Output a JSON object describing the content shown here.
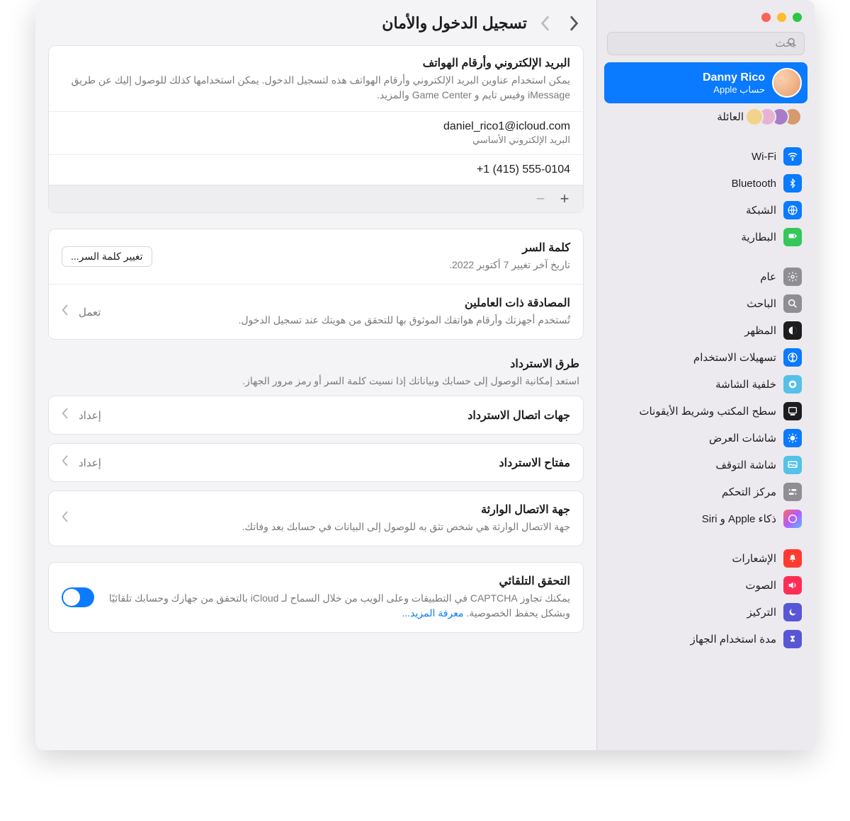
{
  "window": {
    "search_placeholder": "بحث"
  },
  "user": {
    "name": "Danny Rico",
    "sub": "حساب Apple"
  },
  "sidebar": {
    "family": "العائلة",
    "items": [
      {
        "label": "Wi-Fi",
        "color": "#0a7aff",
        "glyph": "wifi"
      },
      {
        "label": "Bluetooth",
        "color": "#0a7aff",
        "glyph": "bt"
      },
      {
        "label": "الشبكة",
        "color": "#0a7aff",
        "glyph": "globe"
      },
      {
        "label": "البطارية",
        "color": "#34c759",
        "glyph": "battery"
      }
    ],
    "items2": [
      {
        "label": "عام",
        "color": "#8e8e93",
        "glyph": "gear"
      },
      {
        "label": "الباحث",
        "color": "#8e8e93",
        "glyph": "search"
      },
      {
        "label": "المظهر",
        "color": "#1d1d1f",
        "glyph": "appearance"
      },
      {
        "label": "تسهيلات الاستخدام",
        "color": "#0a7aff",
        "glyph": "ax"
      },
      {
        "label": "خلفية الشاشة",
        "color": "#55c1e8",
        "glyph": "wallpaper"
      },
      {
        "label": "سطح المكتب وشريط الأيقونات",
        "color": "#1d1d1f",
        "glyph": "dock"
      },
      {
        "label": "شاشات العرض",
        "color": "#0a7aff",
        "glyph": "display"
      },
      {
        "label": "شاشة التوقف",
        "color": "#55c1e8",
        "glyph": "saver"
      },
      {
        "label": "مركز التحكم",
        "color": "#8e8e93",
        "glyph": "cc"
      },
      {
        "label": "ذكاء Apple و Siri",
        "color": "linear-gradient(135deg,#f55,#a5f)",
        "glyph": "siri"
      }
    ],
    "items3": [
      {
        "label": "الإشعارات",
        "color": "#ff3b30",
        "glyph": "bell"
      },
      {
        "label": "الصوت",
        "color": "#ff2d55",
        "glyph": "sound"
      },
      {
        "label": "التركيز",
        "color": "#5856d6",
        "glyph": "moon"
      },
      {
        "label": "مدة استخدام الجهاز",
        "color": "#5856d6",
        "glyph": "time"
      }
    ]
  },
  "title": "تسجيل الدخول والأمان",
  "email_section": {
    "title": "البريد الإلكتروني وأرقام الهواتف",
    "desc": "يمكن استخدام عناوين البريد الإلكتروني وأرقام الهواتف هذه لتسجيل الدخول. يمكن استخدامها كذلك للوصول إليك عن طريق iMessage وفيس تايم و Game Center والمزيد.",
    "email": "daniel_rico1@icloud.com",
    "email_label": "البريد الإلكتروني الأساسي",
    "phone": "+1 (415) 555-0104"
  },
  "password": {
    "title": "كلمة السر",
    "desc": "تاريخ آخر تغيير 7 أكتوبر 2022.",
    "button": "تغيير كلمة السر..."
  },
  "twofa": {
    "title": "المصادقة ذات العاملين",
    "desc": "تُستخدم أجهزتك وأرقام هواتفك الموثوق بها للتحقق من هويتك عند تسجيل الدخول.",
    "status": "تعمل"
  },
  "recovery": {
    "title": "طرق الاسترداد",
    "desc": "استعد إمكانية الوصول إلى حسابك وبياناتك إذا نسيت كلمة السر أو رمز مرور الجهاز.",
    "contacts": "جهات اتصال الاسترداد",
    "key": "مفتاح الاسترداد",
    "setup": "إعداد"
  },
  "legacy": {
    "title": "جهة الاتصال الوارثة",
    "desc": "جهة الاتصال الوارثة هي شخص تثق به للوصول إلى البيانات في حسابك بعد وفاتك."
  },
  "autoverify": {
    "title": "التحقق التلقائي",
    "desc": "يمكنك تجاوز CAPTCHA في التطبيقات وعلى الويب من خلال السماح لـ iCloud بالتحقق من جهازك وحسابك تلقائيًا وبشكل يحفظ الخصوصية. ",
    "more": "معرفة المزيد..."
  }
}
